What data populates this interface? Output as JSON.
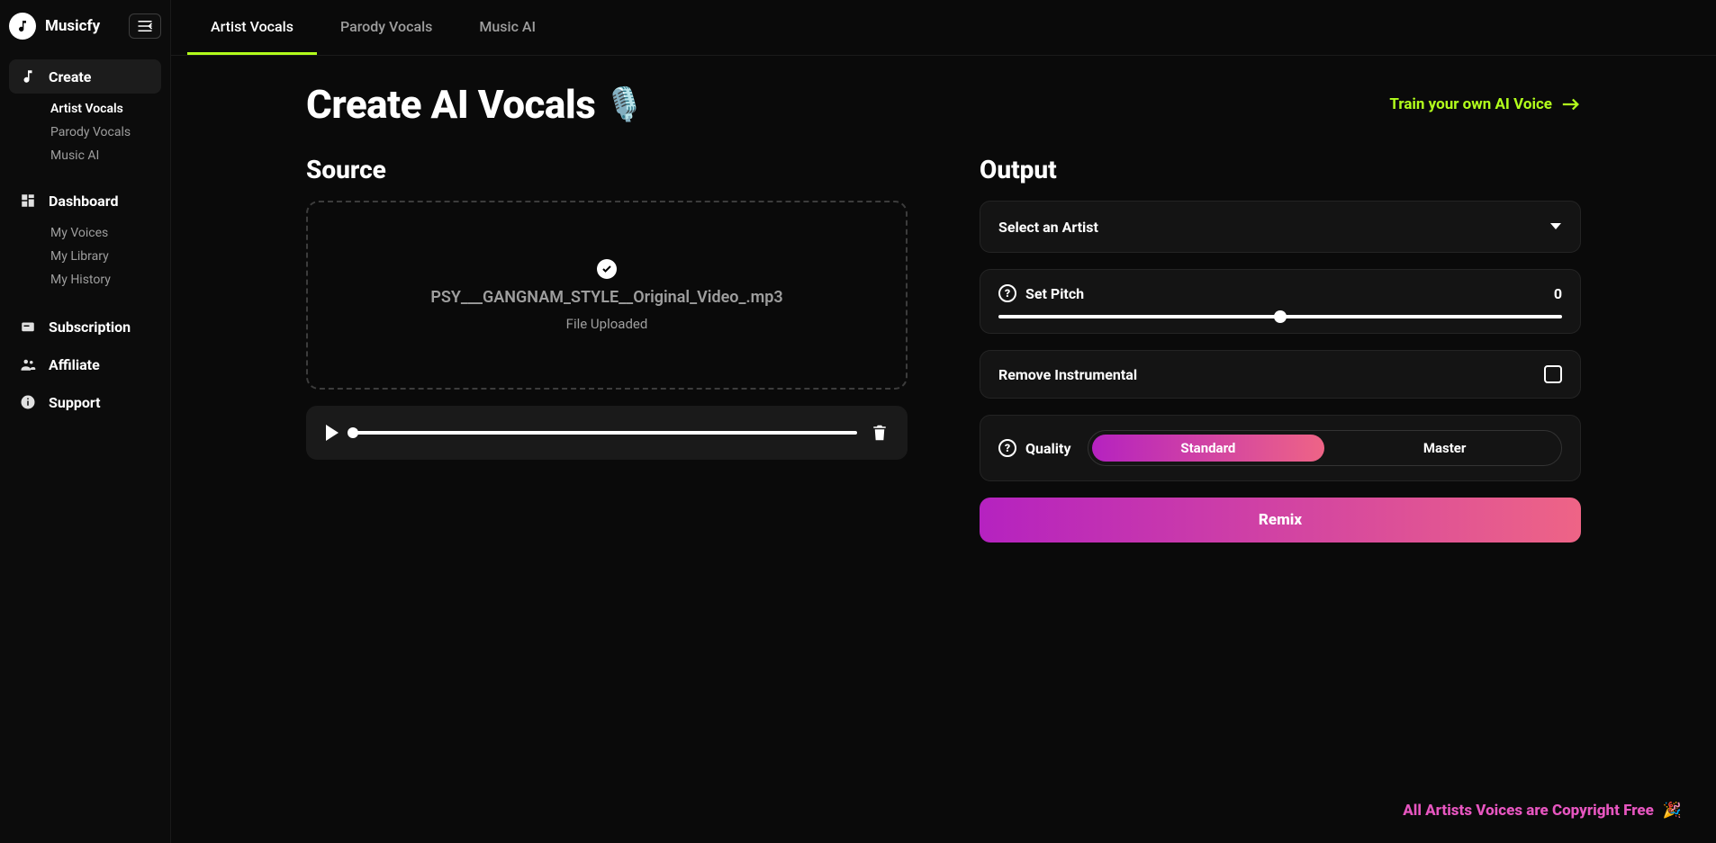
{
  "brand": {
    "name": "Musicfy"
  },
  "topTabs": [
    {
      "label": "Artist Vocals",
      "active": true
    },
    {
      "label": "Parody Vocals",
      "active": false
    },
    {
      "label": "Music AI",
      "active": false
    }
  ],
  "sidebar": {
    "create": {
      "label": "Create",
      "items": [
        {
          "label": "Artist Vocals",
          "active": true
        },
        {
          "label": "Parody Vocals",
          "active": false
        },
        {
          "label": "Music AI",
          "active": false
        }
      ]
    },
    "dashboard": {
      "label": "Dashboard",
      "items": [
        {
          "label": "My Voices"
        },
        {
          "label": "My Library"
        },
        {
          "label": "My History"
        }
      ]
    },
    "subscription": {
      "label": "Subscription"
    },
    "affiliate": {
      "label": "Affiliate"
    },
    "support": {
      "label": "Support"
    }
  },
  "page": {
    "title": "Create AI Vocals",
    "train_link": "Train your own AI Voice"
  },
  "source": {
    "heading": "Source",
    "file_name": "PSY___GANGNAM_STYLE__Original_Video_.mp3",
    "status": "File Uploaded"
  },
  "output": {
    "heading": "Output",
    "select_artist": "Select an Artist",
    "pitch": {
      "label": "Set Pitch",
      "value": "0"
    },
    "remove_instrumental": {
      "label": "Remove Instrumental",
      "checked": false
    },
    "quality": {
      "label": "Quality",
      "options": [
        {
          "label": "Standard",
          "active": true
        },
        {
          "label": "Master",
          "active": false
        }
      ]
    },
    "remix_button": "Remix"
  },
  "footer": {
    "copyright_note": "All Artists Voices are Copyright Free"
  }
}
